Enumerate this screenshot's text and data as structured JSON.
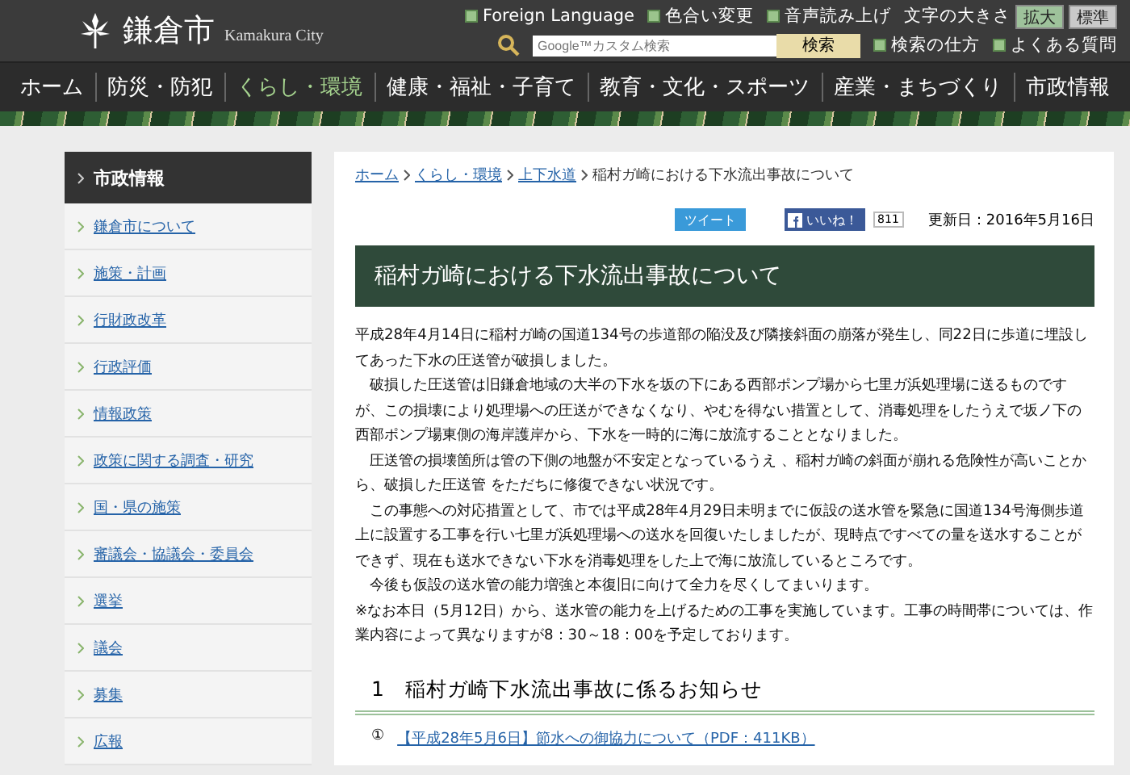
{
  "header": {
    "logo_text": "鎌倉市",
    "logo_sub": "Kamakura City",
    "utility_links": [
      "Foreign Language",
      "色合い変更",
      "音声読み上げ"
    ],
    "font_size_label": "文字の大きさ",
    "font_size_buttons": [
      {
        "label": "拡大",
        "selected": true
      },
      {
        "label": "標準",
        "selected": false
      }
    ],
    "search": {
      "placeholder": "Google™カスタム検索",
      "button": "検索"
    },
    "help_links": [
      "検索の仕方",
      "よくある質問"
    ]
  },
  "nav": [
    {
      "label": "ホーム",
      "selected": false
    },
    {
      "label": "防災・防犯",
      "selected": false
    },
    {
      "label": "くらし・環境",
      "selected": true
    },
    {
      "label": "健康・福祉・子育て",
      "selected": false
    },
    {
      "label": "教育・文化・スポーツ",
      "selected": false
    },
    {
      "label": "産業・まちづくり",
      "selected": false
    },
    {
      "label": "市政情報",
      "selected": false
    }
  ],
  "sidebar": {
    "title": "市政情報",
    "items": [
      "鎌倉市について",
      "施策・計画",
      "行財政改革",
      "行政評価",
      "情報政策",
      "政策に関する調査・研究",
      "国・県の施策",
      "審議会・協議会・委員会",
      "選挙",
      "議会",
      "募集",
      "広報"
    ]
  },
  "breadcrumb": {
    "links": [
      "ホーム",
      "くらし・環境",
      "上下水道"
    ],
    "current": "稲村ガ崎における下水流出事故について"
  },
  "social": {
    "tweet": "ツイート",
    "like": "いいね！",
    "like_count": "811",
    "updated": "更新日：2016年5月16日"
  },
  "title": "稲村ガ崎における下水流出事故について",
  "paragraphs": [
    {
      "text": "平成28年4月14日に稲村ガ崎の国道134号の歩道部の陥没及び隣接斜面の崩落が発生し、同22日に歩道に埋設してあった下水の圧送管が破損しました。",
      "indent": false
    },
    {
      "text": "破損した圧送管は旧鎌倉地域の大半の下水を坂の下にある西部ポンプ場から七里ガ浜処理場に送るものですが、この損壊により処理場への圧送ができなくなり、やむを得ない措置として、消毒処理をしたうえで坂ノ下の西部ポンプ場東側の海岸護岸から、下水を一時的に海に放流することとなりました。",
      "indent": true
    },
    {
      "text": "圧送管の損壊箇所は管の下側の地盤が不安定となっているうえ 、稲村ガ崎の斜面が崩れる危険性が高いことから、破損した圧送管 をただちに修復できない状況です。",
      "indent": true
    },
    {
      "text": "この事態への対応措置として、市では平成28年4月29日未明までに仮設の送水管を緊急に国道134号海側歩道上に設置する工事を行い七里ガ浜処理場への送水を回復いたしましたが、現時点ですべての量を送水することができず、現在も送水できない下水を消毒処理をした上で海に放流しているところです。",
      "indent": true
    },
    {
      "text": "今後も仮設の送水管の能力増強と本復旧に向けて全力を尽くしてまいります。",
      "indent": true
    },
    {
      "text": "※なお本日（5月12日）から、送水管の能力を上げるための工事を実施しています。工事の時間帯については、作業内容によって異なりますが8：30～18：00を予定しております。",
      "indent": false
    }
  ],
  "section": {
    "heading": "1　稲村ガ崎下水流出事故に係るお知らせ",
    "items": [
      {
        "marker": "①",
        "link": "【平成28年5月6日】節水への御協力について（PDF：411KB）"
      }
    ]
  }
}
